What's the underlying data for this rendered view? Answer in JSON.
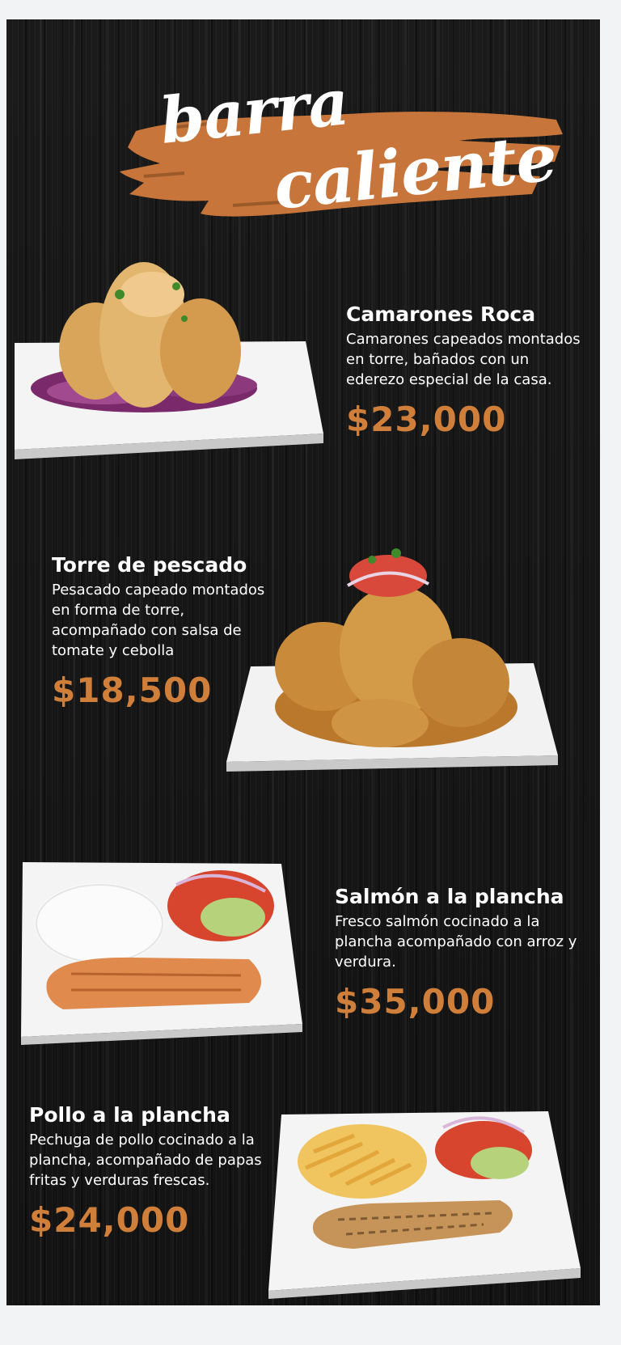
{
  "menu": {
    "title_line1": "barra",
    "title_line2": "caliente",
    "accent_color": "#d07f3a",
    "background_color": "#161616",
    "items": [
      {
        "name": "Camarones Roca",
        "description": "Camarones capeados montados en torre, bañados con un ederezo especial de la casa.",
        "price": "$23,000"
      },
      {
        "name": "Torre de pescado",
        "description": "Pesacado capeado montados en forma de torre, acompañado con salsa de tomate y cebolla",
        "price": "$18,500"
      },
      {
        "name": "Salmón a la plancha",
        "description": "Fresco salmón cocinado a la plancha acompañado con arroz y verdura.",
        "price": "$35,000"
      },
      {
        "name": "Pollo a la plancha",
        "description": "Pechuga de pollo cocinado a la plancha, acompañado de papas fritas y verduras frescas.",
        "price": "$24,000"
      }
    ]
  }
}
